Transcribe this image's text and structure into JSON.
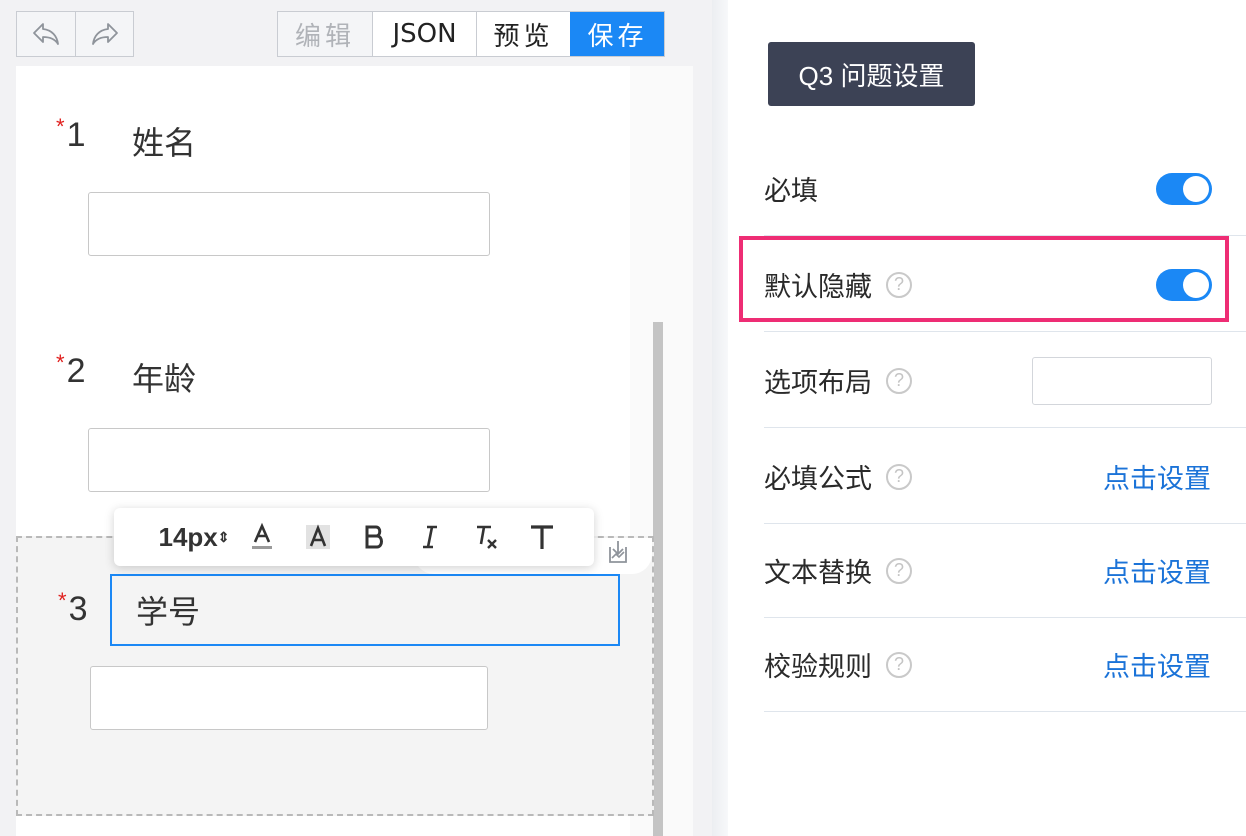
{
  "toolbar": {
    "undo_icon": "undo-icon",
    "redo_icon": "redo-icon",
    "modes": [
      {
        "label": "编辑",
        "state": "disabled"
      },
      {
        "label": "JSON",
        "state": "normal"
      },
      {
        "label": "预览",
        "state": "normal"
      },
      {
        "label": "保存",
        "state": "primary"
      }
    ]
  },
  "questions": [
    {
      "number": "1",
      "title": "姓名",
      "required_mark": "*"
    },
    {
      "number": "2",
      "title": "年龄",
      "required_mark": "*"
    },
    {
      "number": "3",
      "title": "学号",
      "required_mark": "*"
    }
  ],
  "text_toolbar": {
    "font_size": "14px",
    "tools": [
      "font-color-icon",
      "background-color-icon",
      "bold-icon",
      "italic-icon",
      "clear-format-icon",
      "text-icon"
    ]
  },
  "settings": {
    "title": "Q3 问题设置",
    "rows": [
      {
        "label": "必填",
        "help": false,
        "control": "toggle",
        "value": true
      },
      {
        "label": "默认隐藏",
        "help": true,
        "control": "toggle",
        "value": true
      },
      {
        "label": "选项布局",
        "help": true,
        "control": "select",
        "value": ""
      },
      {
        "label": "必填公式",
        "help": true,
        "control": "link",
        "value": "点击设置"
      },
      {
        "label": "文本替换",
        "help": true,
        "control": "link",
        "value": "点击设置"
      },
      {
        "label": "校验规则",
        "help": true,
        "control": "link",
        "value": "点击设置"
      }
    ],
    "help_glyph": "?"
  },
  "colors": {
    "primary": "#1b88f5",
    "highlight": "#ee2d74",
    "panel_title_bg": "#3c4255",
    "link": "#1b73d8"
  }
}
